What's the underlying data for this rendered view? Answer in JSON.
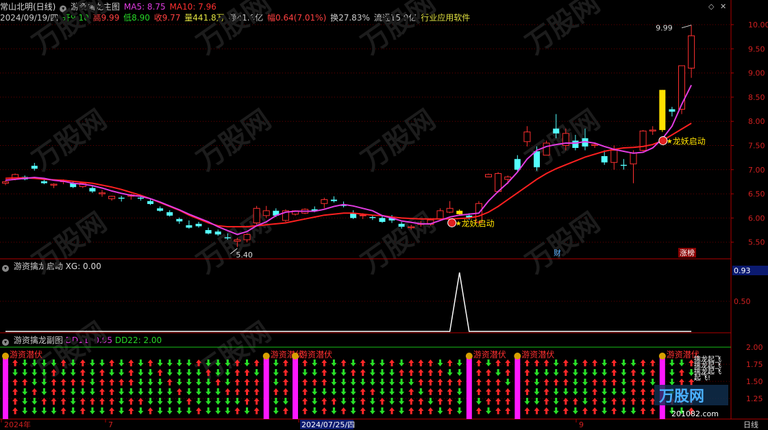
{
  "header": {
    "stock_name": "常山北明(日线)",
    "indicator_name": "游资擒龙主图",
    "ma5_label": "MA5: 8.75",
    "ma10_label": "MA10: 7.96",
    "date": "2024/09/19/四",
    "open": "开9.10",
    "high": "高9.99",
    "low": "低8.90",
    "close": "收9.77",
    "volume": "量441.8万",
    "amount": "额41.8亿",
    "change": "幅0.64(7.01%)",
    "turnover": "换27.83%",
    "float": "流通15.9亿",
    "industry": "行业应用软件",
    "window_buttons": [
      "◇",
      "✕"
    ]
  },
  "main_chart": {
    "price_axis": [
      "10.00",
      "9.50",
      "9.00",
      "8.50",
      "8.00",
      "7.50",
      "7.00",
      "6.50",
      "6.00",
      "5.50"
    ],
    "high_label": "9.99",
    "low_label": "5.40",
    "signal_label": "龙妖启动",
    "badge_cai": "财",
    "badge_zhangbang": "涨榜"
  },
  "panel2": {
    "title": "游资擒龙启动",
    "xg_label": "XG: 0.00",
    "axis": [
      "0.93",
      "0.50"
    ]
  },
  "panel3": {
    "title": "游资擒龙副图",
    "dd11_label": "DD11: 0.95",
    "dd22_label": "DD22: 2.00",
    "axis": [
      "2.00",
      "1.75",
      "1.50",
      "1.25"
    ],
    "signal_label": "游资潜伏",
    "side_labels": [
      "擒龙起飞",
      "擒龙起飞",
      "擒龙起飞",
      "起飞!"
    ]
  },
  "time_axis": {
    "labels": [
      "2024年",
      "7",
      "2024/07/25/四",
      "9"
    ],
    "period_label": "日线"
  },
  "watermark": "万股网",
  "watermark_url": "201082.com",
  "chart_data": {
    "type": "candlestick",
    "ohlc": [
      [
        6.72,
        6.78,
        6.68,
        6.75
      ],
      [
        6.8,
        6.92,
        6.78,
        6.9
      ],
      [
        6.85,
        6.88,
        6.78,
        6.8
      ],
      [
        7.08,
        7.14,
        6.98,
        7.02
      ],
      [
        6.76,
        6.82,
        6.7,
        6.72
      ],
      [
        6.68,
        6.72,
        6.62,
        6.7
      ],
      [
        6.75,
        6.8,
        6.7,
        6.78
      ],
      [
        6.72,
        6.75,
        6.62,
        6.64
      ],
      [
        6.65,
        6.74,
        6.62,
        6.72
      ],
      [
        6.62,
        6.66,
        6.52,
        6.55
      ],
      [
        6.5,
        6.58,
        6.44,
        6.52
      ],
      [
        6.4,
        6.46,
        6.36,
        6.45
      ],
      [
        6.42,
        6.46,
        6.34,
        6.4
      ],
      [
        6.45,
        6.5,
        6.38,
        6.48
      ],
      [
        6.42,
        6.45,
        6.36,
        6.4
      ],
      [
        6.35,
        6.4,
        6.27,
        6.29
      ],
      [
        6.2,
        6.24,
        6.13,
        6.15
      ],
      [
        6.12,
        6.16,
        6.03,
        6.05
      ],
      [
        5.98,
        6.01,
        5.88,
        5.93
      ],
      [
        5.85,
        5.95,
        5.78,
        5.8
      ],
      [
        5.88,
        5.92,
        5.8,
        5.83
      ],
      [
        5.75,
        5.8,
        5.66,
        5.68
      ],
      [
        5.72,
        5.76,
        5.63,
        5.66
      ],
      [
        5.6,
        5.68,
        5.55,
        5.58
      ],
      [
        5.52,
        5.59,
        5.4,
        5.55
      ],
      [
        5.55,
        5.68,
        5.5,
        5.66
      ],
      [
        5.9,
        6.25,
        5.86,
        6.2
      ],
      [
        6.05,
        6.25,
        6.0,
        6.15
      ],
      [
        6.15,
        6.2,
        6.02,
        6.05
      ],
      [
        5.95,
        6.18,
        5.92,
        6.15
      ],
      [
        6.08,
        6.16,
        6.05,
        6.15
      ],
      [
        6.1,
        6.2,
        6.08,
        6.18
      ],
      [
        6.18,
        6.24,
        6.12,
        6.15
      ],
      [
        6.3,
        6.42,
        6.2,
        6.38
      ],
      [
        6.38,
        6.45,
        6.32,
        6.35
      ],
      [
        6.28,
        6.34,
        6.22,
        6.25
      ],
      [
        6.1,
        6.16,
        5.98,
        6.0
      ],
      [
        6.05,
        6.1,
        5.98,
        6.06
      ],
      [
        6.02,
        6.06,
        5.96,
        6.0
      ],
      [
        6.0,
        6.05,
        5.9,
        5.92
      ],
      [
        6.02,
        6.06,
        5.9,
        5.95
      ],
      [
        5.88,
        5.92,
        5.78,
        5.82
      ],
      [
        5.8,
        5.86,
        5.76,
        5.82
      ],
      [
        5.88,
        5.94,
        5.82,
        5.88
      ],
      [
        5.87,
        5.98,
        5.84,
        5.96
      ],
      [
        5.98,
        6.2,
        5.95,
        6.15
      ],
      [
        6.12,
        6.35,
        6.1,
        6.2
      ],
      [
        6.15,
        6.18,
        6.06,
        6.08
      ],
      [
        6.05,
        6.1,
        5.96,
        6.0
      ],
      [
        5.92,
        6.35,
        5.88,
        6.3
      ],
      [
        6.85,
        6.92,
        6.86,
        6.9
      ],
      [
        6.55,
        6.95,
        6.52,
        6.92
      ],
      [
        6.8,
        6.88,
        6.7,
        6.85
      ],
      [
        7.22,
        7.3,
        6.95,
        7.0
      ],
      [
        7.58,
        7.9,
        7.48,
        7.78
      ],
      [
        7.38,
        7.48,
        6.98,
        7.05
      ],
      [
        7.3,
        7.6,
        7.3,
        7.55
      ],
      [
        7.85,
        8.15,
        7.65,
        7.75
      ],
      [
        7.5,
        7.85,
        7.4,
        7.75
      ],
      [
        7.6,
        7.72,
        7.4,
        7.45
      ],
      [
        7.65,
        7.85,
        7.4,
        7.48
      ],
      [
        7.5,
        7.55,
        7.45,
        7.52
      ],
      [
        7.28,
        7.4,
        7.1,
        7.15
      ],
      [
        7.15,
        7.5,
        7.0,
        7.4
      ],
      [
        7.1,
        7.22,
        7.0,
        7.08
      ],
      [
        7.12,
        7.4,
        6.72,
        7.35
      ],
      [
        7.4,
        7.82,
        7.38,
        7.8
      ],
      [
        7.8,
        7.9,
        7.72,
        7.82
      ],
      [
        7.82,
        8.65,
        7.78,
        8.65
      ],
      [
        8.25,
        8.3,
        8.1,
        8.2
      ],
      [
        8.25,
        9.15,
        8.15,
        9.15
      ],
      [
        9.1,
        9.99,
        8.9,
        9.77
      ]
    ],
    "ma5": [
      6.78,
      6.8,
      6.82,
      6.84,
      6.82,
      6.78,
      6.76,
      6.72,
      6.7,
      6.67,
      6.62,
      6.56,
      6.51,
      6.47,
      6.45,
      6.4,
      6.33,
      6.25,
      6.17,
      6.08,
      6.0,
      5.92,
      5.82,
      5.74,
      5.66,
      5.72,
      5.84,
      5.92,
      6.05,
      6.12,
      6.14,
      6.14,
      6.14,
      6.18,
      6.24,
      6.28,
      6.25,
      6.2,
      6.15,
      6.05,
      6.0,
      5.94,
      5.91,
      5.88,
      5.88,
      5.95,
      6.02,
      6.06,
      6.08,
      6.1,
      6.35,
      6.55,
      6.73,
      6.95,
      7.22,
      7.4,
      7.48,
      7.52,
      7.55,
      7.55,
      7.58,
      7.55,
      7.48,
      7.42,
      7.38,
      7.34,
      7.36,
      7.45,
      7.64,
      7.9,
      8.35,
      8.75
    ],
    "ma10": [
      6.82,
      6.83,
      6.83,
      6.82,
      6.8,
      6.79,
      6.78,
      6.76,
      6.74,
      6.72,
      6.68,
      6.64,
      6.59,
      6.53,
      6.47,
      6.4,
      6.32,
      6.24,
      6.16,
      6.06,
      5.98,
      5.9,
      5.84,
      5.82,
      5.82,
      5.82,
      5.84,
      5.86,
      5.88,
      5.9,
      5.94,
      5.98,
      6.02,
      6.06,
      6.08,
      6.1,
      6.1,
      6.08,
      6.06,
      6.05,
      6.02,
      6.0,
      5.99,
      5.98,
      5.98,
      5.98,
      5.98,
      5.99,
      6.0,
      6.04,
      6.12,
      6.24,
      6.38,
      6.52,
      6.66,
      6.8,
      6.92,
      7.02,
      7.1,
      7.18,
      7.26,
      7.32,
      7.38,
      7.42,
      7.45,
      7.46,
      7.48,
      7.52,
      7.6,
      7.72,
      7.84,
      7.96
    ],
    "xg": [
      0,
      0,
      0,
      0,
      0,
      0,
      0,
      0,
      0,
      0,
      0,
      0,
      0,
      0,
      0,
      0,
      0,
      0,
      0,
      0,
      0,
      0,
      0,
      0,
      0,
      0,
      0,
      0,
      0,
      0,
      0,
      0,
      0,
      0,
      0,
      0,
      0,
      0,
      0,
      0,
      0,
      0,
      0,
      0,
      0,
      0,
      0,
      1,
      0,
      0,
      0,
      0,
      0,
      0,
      0,
      0,
      0,
      0,
      0,
      0,
      0,
      0,
      0,
      0,
      0,
      0,
      0,
      0,
      0,
      0,
      0,
      0
    ],
    "signal_bars": [
      0,
      27,
      30,
      48,
      53,
      68
    ],
    "yellow_bars": [
      47,
      68
    ]
  }
}
